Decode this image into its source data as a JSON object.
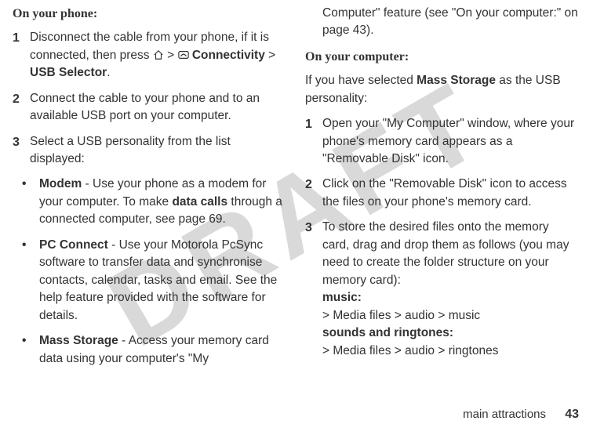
{
  "watermark": "DRAFT",
  "left": {
    "heading": "On your phone:",
    "steps": [
      {
        "n": "1",
        "parts": [
          {
            "t": "Disconnect the cable from your phone, if it is connected, then press "
          },
          {
            "icon": "home"
          },
          {
            "t": " > "
          },
          {
            "icon": "link"
          },
          {
            "t": " "
          },
          {
            "t": "Connectivity",
            "b": true
          },
          {
            "t": " > "
          },
          {
            "t": "USB Selector",
            "b": true
          },
          {
            "t": "."
          }
        ]
      },
      {
        "n": "2",
        "parts": [
          {
            "t": "Connect the cable to your phone and to an available USB port on your computer."
          }
        ]
      },
      {
        "n": "3",
        "parts": [
          {
            "t": "Select a USB personality from the list displayed:"
          }
        ]
      }
    ],
    "bullets": [
      {
        "parts": [
          {
            "t": "Modem",
            "b": true
          },
          {
            "t": " - Use your phone as a modem for your computer. To make "
          },
          {
            "t": "data calls",
            "bb": true
          },
          {
            "t": " through a connected computer, see page 69."
          }
        ]
      },
      {
        "parts": [
          {
            "t": "PC Connect",
            "b": true
          },
          {
            "t": " - Use your Motorola PcSync software to transfer data and synchronise contacts, calendar, tasks and email. See the help feature provided with the software for details."
          }
        ]
      },
      {
        "parts": [
          {
            "t": "Mass Storage",
            "b": true
          },
          {
            "t": " - Access your memory card data using your computer's \"My"
          }
        ]
      }
    ]
  },
  "right": {
    "continuation": "Computer\" feature (see \"On your computer:\" on page 43).",
    "heading": "On your computer:",
    "introParts": [
      {
        "t": "If you have selected "
      },
      {
        "t": "Mass Storage",
        "b": true
      },
      {
        "t": " as the USB personality:"
      }
    ],
    "steps": [
      {
        "n": "1",
        "parts": [
          {
            "t": "Open your \"My Computer\" window, where your phone's memory card appears as a \"Removable Disk\" icon."
          }
        ]
      },
      {
        "n": "2",
        "parts": [
          {
            "t": "Click on the \"Removable Disk\" icon to access the files on your phone's memory card."
          }
        ]
      },
      {
        "n": "3",
        "parts": [
          {
            "t": "To store the desired files onto the memory card, drag and drop them as follows (you may need to create the folder structure on your memory card):"
          },
          {
            "br": true
          },
          {
            "t": "music:",
            "bb": true
          },
          {
            "br": true
          },
          {
            "t": "> Media files > audio > music"
          },
          {
            "br": true
          },
          {
            "t": "sounds and ringtones:",
            "bb": true
          },
          {
            "br": true
          },
          {
            "t": "> Media files > audio > ringtones"
          }
        ]
      }
    ]
  },
  "footer": {
    "section": "main attractions",
    "page": "43"
  },
  "icons": {
    "home": "⌂",
    "link": "⦿"
  }
}
